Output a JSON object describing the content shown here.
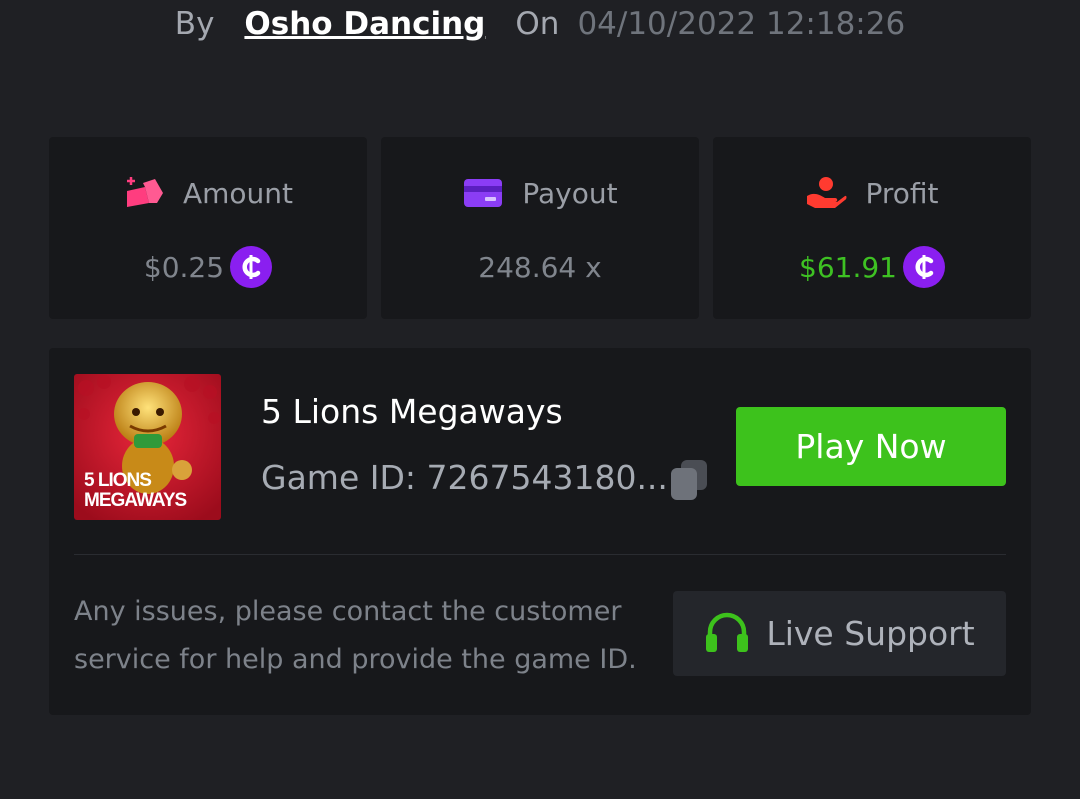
{
  "header": {
    "by_label": "By",
    "username": "Osho Dancing",
    "on_label": "On",
    "datetime": "04/10/2022 12:18:26"
  },
  "stats": {
    "amount": {
      "label": "Amount",
      "value": "$0.25",
      "icon": "bet-chips-icon",
      "icon_color": "#ff3d7f"
    },
    "payout": {
      "label": "Payout",
      "value": "248.64 x",
      "icon": "credit-card-icon",
      "icon_color": "#8b3df5"
    },
    "profit": {
      "label": "Profit",
      "value": "$61.91",
      "icon": "hand-profit-icon",
      "icon_color": "#ff3b30",
      "value_color": "#3ec123"
    },
    "currency_icon": "coin-c-icon",
    "currency_color": "#8a1ff0"
  },
  "game": {
    "title": "5 Lions Megaways",
    "id_text": "Game ID: 7267543180...",
    "thumbnail_text_line1": "5 LIONS",
    "thumbnail_text_line2": "MEGAWAYS",
    "play_label": "Play Now",
    "play_color": "#3dc21c"
  },
  "support": {
    "help_text": "Any issues, please contact the customer service for help and provide the game ID.",
    "button_label": "Live Support",
    "icon": "headset-icon",
    "icon_color": "#3dc21c"
  }
}
